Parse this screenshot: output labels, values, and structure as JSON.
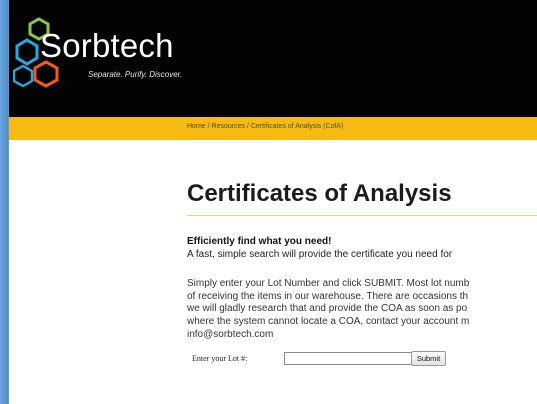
{
  "brand": {
    "name": "Sorbtech",
    "tagline": "Separate. Purify. Discover.",
    "colors": {
      "header_bg": "#030303",
      "accent": "#f6bb12",
      "hex_green": "#8dc63f",
      "hex_blue": "#29a8df",
      "hex_orange": "#f15a24"
    }
  },
  "breadcrumb": {
    "items": [
      "Home",
      "Resources",
      "Certificates of Analysis (CofA)"
    ],
    "separator": "/"
  },
  "main": {
    "title": "Certificates of Analysis",
    "subheading": "Efficiently find what you need!",
    "lead": "A fast, simple search will provide the certificate you need for",
    "body_lines": [
      "Simply enter your Lot Number and click SUBMIT. Most lot numb",
      "of receiving the items in our warehouse. There are occasions th",
      "we will gladly research that and provide the COA as soon as po",
      "where the system cannot locate a COA, contact your account m",
      "info@sorbtech.com"
    ]
  },
  "lot_form": {
    "label": "Enter your Lot #:",
    "input_value": "",
    "input_placeholder": "",
    "submit_label": "Submit"
  }
}
